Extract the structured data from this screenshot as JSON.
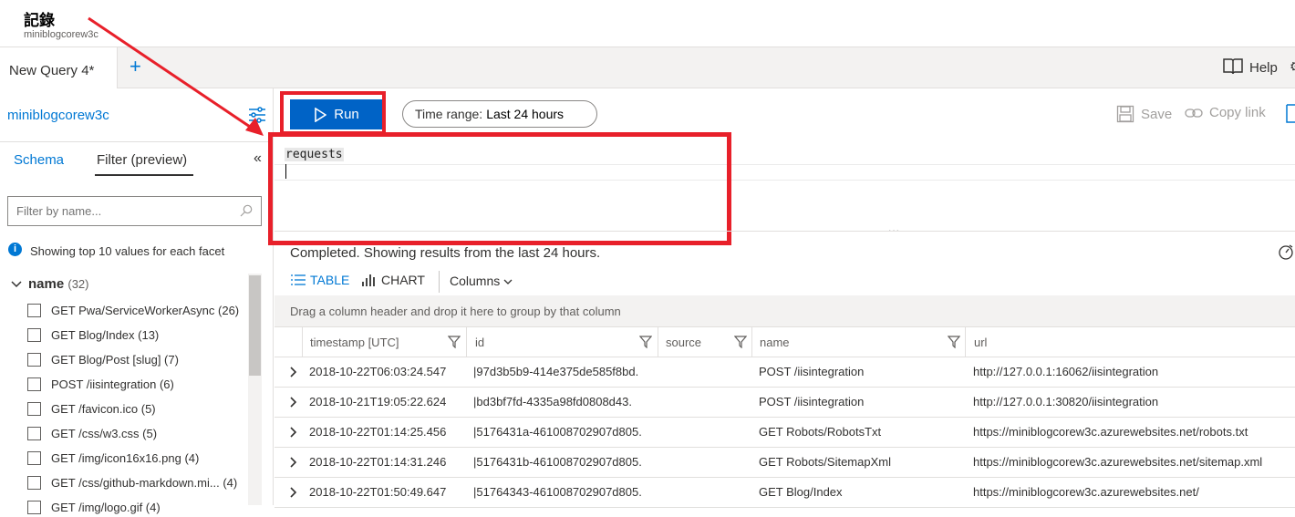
{
  "header": {
    "title": "記錄",
    "subtitle": "miniblogcorew3c"
  },
  "tabs": {
    "active_label": "New Query 4*",
    "new_tab": "+",
    "help_label": "Help"
  },
  "toolbar": {
    "workspace": "miniblogcorew3c",
    "run_label": "Run",
    "time_range_label": "Time range:",
    "time_range_value": "Last 24 hours",
    "save_label": "Save",
    "copy_link_label": "Copy link"
  },
  "left_panel": {
    "tab_schema": "Schema",
    "tab_filter": "Filter (preview)",
    "filter_placeholder": "Filter by name...",
    "info_text": "Showing top 10 values for each facet",
    "facet": {
      "name": "name",
      "count": "(32)",
      "items": [
        "GET Pwa/ServiceWorkerAsync (26)",
        "GET Blog/Index (13)",
        "GET Blog/Post [slug] (7)",
        "POST /iisintegration (6)",
        "GET /favicon.ico (5)",
        "GET /css/w3.css (5)",
        "GET /img/icon16x16.png (4)",
        "GET /css/github-markdown.mi... (4)",
        "GET /img/logo.gif (4)"
      ]
    }
  },
  "editor": {
    "query": "requests",
    "resize_handle": "..."
  },
  "results": {
    "status": "Completed. Showing results from the last 24 hours.",
    "view_table": "TABLE",
    "view_chart": "CHART",
    "columns_label": "Columns",
    "group_hint": "Drag a column header and drop it here to group by that column",
    "columns": [
      "timestamp [UTC]",
      "id",
      "source",
      "name",
      "url"
    ],
    "rows": [
      {
        "timestamp": "2018-10-22T06:03:24.547",
        "id": "|97d3b5b9-414e375de585f8bd.",
        "source": "",
        "name": "POST /iisintegration",
        "url": "http://127.0.0.1:16062/iisintegration"
      },
      {
        "timestamp": "2018-10-21T19:05:22.624",
        "id": "|bd3bf7fd-4335a98fd0808d43.",
        "source": "",
        "name": "POST /iisintegration",
        "url": "http://127.0.0.1:30820/iisintegration"
      },
      {
        "timestamp": "2018-10-22T01:14:25.456",
        "id": "|5176431a-461008702907d805.",
        "source": "",
        "name": "GET Robots/RobotsTxt",
        "url": "https://miniblogcorew3c.azurewebsites.net/robots.txt"
      },
      {
        "timestamp": "2018-10-22T01:14:31.246",
        "id": "|5176431b-461008702907d805.",
        "source": "",
        "name": "GET Robots/SitemapXml",
        "url": "https://miniblogcorew3c.azurewebsites.net/sitemap.xml"
      },
      {
        "timestamp": "2018-10-22T01:50:49.647",
        "id": "|51764343-461008702907d805.",
        "source": "",
        "name": "GET Blog/Index",
        "url": "https://miniblogcorew3c.azurewebsites.net/"
      }
    ]
  },
  "colors": {
    "accent": "#0078d4",
    "run_button": "#0063c6",
    "annotation_red": "#e8202a"
  }
}
